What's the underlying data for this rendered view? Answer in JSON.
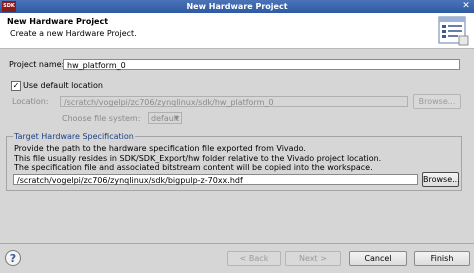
{
  "window": {
    "title": "New Hardware Project",
    "app_icon": "SDK"
  },
  "header": {
    "title": "New Hardware Project",
    "description": "Create a new Hardware Project."
  },
  "project_name": {
    "label": "Project name:",
    "value": "hw_platform_0"
  },
  "default_location": {
    "label": "Use default location",
    "checked": true,
    "check_mark": "✓"
  },
  "location": {
    "label": "Location:",
    "value": "/scratch/vogelpi/zc706/zynqlinux/sdk/hw_platform_0",
    "browse_label": "Browse..."
  },
  "file_system": {
    "label": "Choose file system:",
    "value": "default"
  },
  "target": {
    "title": "Target Hardware Specification",
    "lines": [
      "Provide the path to the hardware specification file exported from Vivado.",
      "This file usually resides in SDK/SDK_Export/hw folder relative to the Vivado project location.",
      "The specification file and associated bitstream content will be copied into the workspace."
    ],
    "path": "/scratch/vogelpi/zc706/zynqlinux/sdk/bigpulp-z-70xx.hdf",
    "browse_label": "Browse..."
  },
  "footer": {
    "back": "< Back",
    "next": "Next >",
    "cancel": "Cancel",
    "finish": "Finish"
  }
}
